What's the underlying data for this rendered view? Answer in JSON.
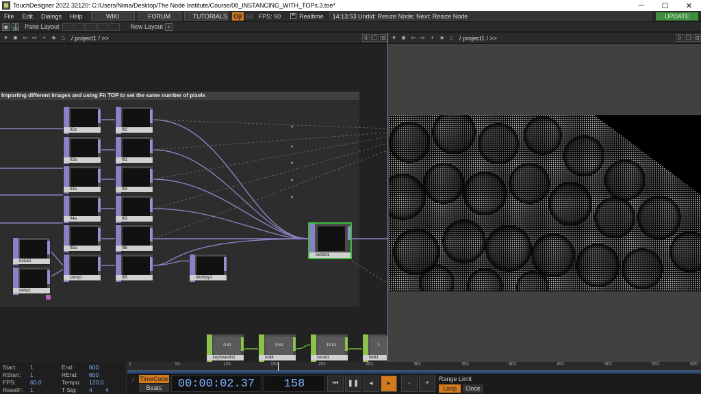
{
  "window": {
    "title": "TouchDesigner 2022.32120: C:/Users/Nima/Desktop/The Node Institute/Course/08_INSTANCING_WITH_TOPs.3.toe*",
    "minimize": "─",
    "maximize": "☐",
    "close": "✕"
  },
  "menu": {
    "items": [
      "File",
      "Edit",
      "Dialogs",
      "Help"
    ],
    "wiki": "WIKI",
    "forum": "FORUM",
    "tutorials": "TUTORIALS",
    "oi": "O|I",
    "sixty": "60",
    "fps": "FPS:  60",
    "realtime": "Realtime",
    "status": "14:13:53 Undid: Resize Node; Next: Resize Node",
    "update": "UPDATE"
  },
  "layoutbar": {
    "pane_layout": "Pane Layout",
    "new_layout": "New Layout",
    "plus": "+"
  },
  "pane_left": {
    "path": "/ project1 / >>",
    "zero": "0"
  },
  "pane_right": {
    "path": "/ project1 / >>",
    "zero": "0"
  },
  "network": {
    "comment": "Importing different images and using Fit TOP to set the same number of pixels",
    "nodes": [
      {
        "name": "02a",
        "view": "v-pink"
      },
      {
        "name": "fit2",
        "view": "v-pink"
      },
      {
        "name": "02a",
        "view": "v-blue"
      },
      {
        "name": "fit1",
        "view": "v-blue"
      },
      {
        "name": "03a",
        "view": "v-eye"
      },
      {
        "name": "fit4",
        "view": "v-eye"
      },
      {
        "name": "04a",
        "view": "v-leaf"
      },
      {
        "name": "fit3",
        "view": "v-leaf"
      },
      {
        "name": "05a",
        "view": "v-gleaf"
      },
      {
        "name": "fit6",
        "view": "v-gleaf"
      },
      {
        "name": "noise1",
        "view": "v-noise"
      },
      {
        "name": "ramp1",
        "view": "v-ramp"
      },
      {
        "name": "comp1",
        "view": "v-comp"
      },
      {
        "name": "fit5",
        "view": "v-comp"
      },
      {
        "name": "multiply1",
        "view": "v-mult"
      },
      {
        "name": "switch1",
        "view": "v-blue"
      }
    ],
    "chops": [
      {
        "name": "keyboardin1",
        "value": "0 k1"
      },
      {
        "name": "null4",
        "value": "0 k1"
      },
      {
        "name": "count1",
        "value": "10 k1"
      },
      {
        "name": "limit1",
        "value": "1"
      }
    ]
  },
  "timeline": {
    "start_label": "Start:",
    "start": "1",
    "end_label": "End:",
    "end": "600",
    "rstart_label": "RStart:",
    "rstart": "1",
    "rend_label": "REnd:",
    "rend": "600",
    "fps_label": "FPS:",
    "fps": "60.0",
    "tempo_label": "Tempo:",
    "tempo": "120.0",
    "resetf_label": "ResetF:",
    "resetf": "1",
    "tsig_label": "T Sig:",
    "tsig_a": "4",
    "tsig_b": "4",
    "ticks": [
      "1",
      "51",
      "101",
      "151",
      "201",
      "251",
      "301",
      "351",
      "401",
      "451",
      "501",
      "551",
      "600"
    ],
    "timecode_btn": "TimeCode",
    "beats_btn": "Beats",
    "timecode": "00:00:02.37",
    "frame": "158",
    "range_limit": "Range Limit",
    "loop": "Loop",
    "once": "Once"
  }
}
